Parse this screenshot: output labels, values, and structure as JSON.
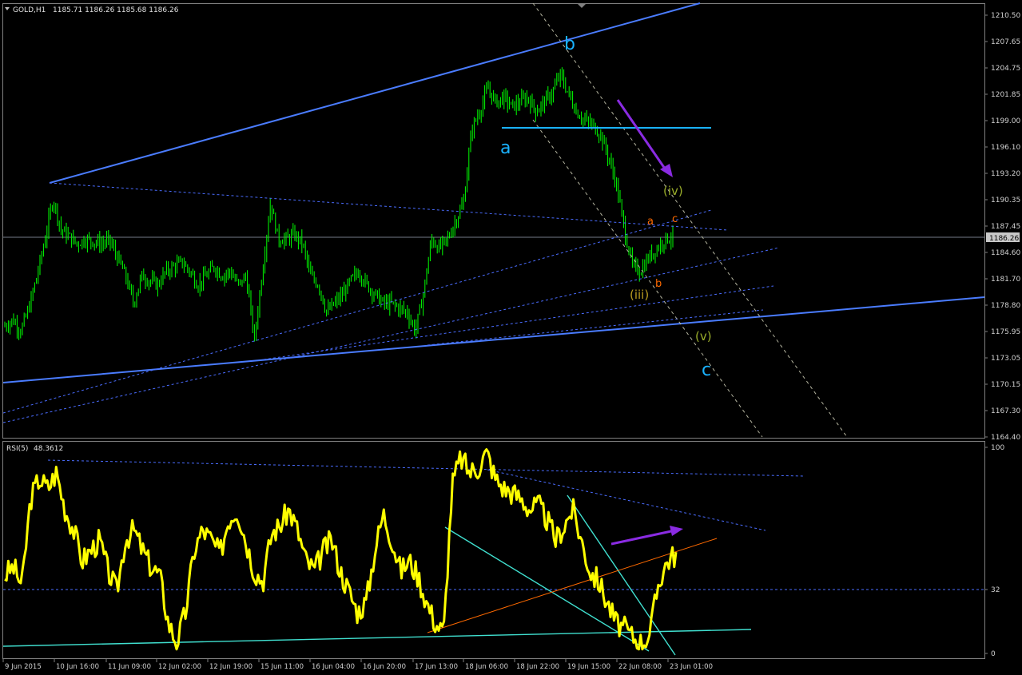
{
  "main_panel": {
    "symbol_label": "GOLD,H1",
    "ohlc": "1185.71 1186.26 1185.68 1186.26",
    "current_price": "1186.26",
    "price_scale": [
      "1210.50",
      "1207.65",
      "1204.75",
      "1201.85",
      "1199.00",
      "1196.10",
      "1193.20",
      "1190.35",
      "1187.45",
      "1184.60",
      "1181.70",
      "1178.80",
      "1175.95",
      "1173.05",
      "1170.15",
      "1167.30",
      "1164.40"
    ],
    "wave_labels": {
      "b_major": "b",
      "a_major": "a",
      "c_major": "c",
      "iv": "(iv)",
      "iii": "(iii)",
      "v": "(v)",
      "a_minor": "a",
      "b_minor": "b",
      "c_minor": "c"
    }
  },
  "rsi_panel": {
    "title": "RSI(5)",
    "value": "48.3612",
    "scale": [
      "100",
      "32",
      "0"
    ]
  },
  "time_axis": [
    "9 Jun 2015",
    "10 Jun 16:00",
    "11 Jun 09:00",
    "12 Jun 02:00",
    "12 Jun 19:00",
    "15 Jun 11:00",
    "16 Jun 04:00",
    "16 Jun 20:00",
    "17 Jun 13:00",
    "18 Jun 06:00",
    "18 Jun 22:00",
    "19 Jun 15:00",
    "22 Jun 08:00",
    "23 Jun 01:00"
  ],
  "colors": {
    "candles": "#00ff00",
    "channel": "#4a7cff",
    "rsi_line": "#ffff00",
    "cyan": "#00bfff",
    "purple": "#8a2be2",
    "olive": "#9aad2a",
    "orange": "#ff6a00",
    "teal": "#40e0d0"
  },
  "chart_data": [
    {
      "type": "candlestick",
      "title": "GOLD,H1",
      "ylim": [
        1164.4,
        1210.5
      ],
      "close_path": [
        1176.5,
        1177.2,
        1176.0,
        1178.5,
        1182.0,
        1186.0,
        1190.5,
        1187.0,
        1186.3,
        1185.5,
        1186.0,
        1185.8,
        1185.5,
        1185.9,
        1184.0,
        1182.0,
        1179.0,
        1182.0,
        1181.5,
        1181.0,
        1182.5,
        1183.0,
        1183.5,
        1182.5,
        1181.0,
        1182.0,
        1183.0,
        1182.0,
        1182.5,
        1181.0,
        1182.0,
        1175.0,
        1182.5,
        1190.0,
        1186.0,
        1186.0,
        1186.5,
        1185.5,
        1182.0,
        1181.0,
        1178.0,
        1179.0,
        1180.0,
        1181.5,
        1182.5,
        1181.0,
        1180.0,
        1179.0,
        1179.0,
        1178.5,
        1178.0,
        1176.0,
        1180.0,
        1186.0,
        1185.0,
        1186.0,
        1188.0,
        1190.0,
        1198.0,
        1200.0,
        1202.5,
        1201.0,
        1201.5,
        1200.5,
        1201.0,
        1201.5,
        1200.0,
        1201.0,
        1202.0,
        1204.0,
        1202.0,
        1200.0,
        1199.0,
        1198.5,
        1197.5,
        1195.0,
        1192.0,
        1187.0,
        1183.0,
        1182.5,
        1184.0,
        1185.0,
        1186.0,
        1186.26
      ],
      "annotations": [
        "b",
        "a",
        "c",
        "(iv)",
        "(iii)",
        "(v)",
        "a",
        "b",
        "c"
      ]
    },
    {
      "type": "line",
      "title": "RSI(5)",
      "ylim": [
        0,
        100
      ],
      "series": [
        {
          "name": "RSI(5)",
          "values": [
            38,
            42,
            33,
            75,
            85,
            80,
            88,
            70,
            60,
            45,
            50,
            55,
            40,
            30,
            55,
            60,
            50,
            42,
            38,
            15,
            5,
            20,
            50,
            60,
            55,
            48,
            65,
            70,
            55,
            40,
            35,
            58,
            62,
            70,
            60,
            45,
            40,
            50,
            55,
            40,
            30,
            20,
            25,
            50,
            68,
            55,
            40,
            45,
            38,
            25,
            15,
            10,
            82,
            95,
            88,
            90,
            98,
            85,
            80,
            78,
            75,
            70,
            72,
            65,
            55,
            62,
            70,
            55,
            40,
            35,
            25,
            15,
            12,
            8,
            5,
            10,
            35,
            45,
            48.4
          ]
        }
      ],
      "reference_lines": [
        32
      ]
    }
  ]
}
